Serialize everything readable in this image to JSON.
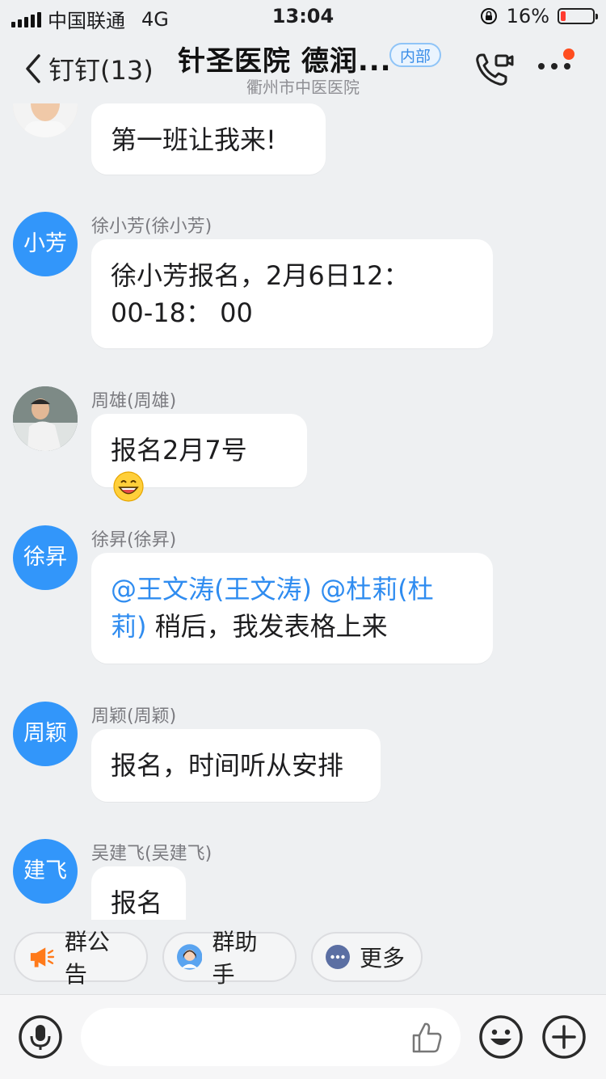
{
  "status_bar": {
    "carrier": "中国联通",
    "network": "4G",
    "time": "13:04",
    "battery": "16%",
    "battery_level": 0.16
  },
  "nav": {
    "back_label": "钉钉(13)",
    "title": "针圣医院 德润...",
    "tag": "内部",
    "subtitle": "衢州市中医医院"
  },
  "messages": [
    {
      "avatar_text": "",
      "sender": "",
      "text": "第一班让我来!"
    },
    {
      "avatar_text": "小芳",
      "sender": "徐小芳(徐小芳)",
      "line1": "徐小芳报名，2月6日12：",
      "line2": "00-18：  00"
    },
    {
      "avatar_text": "",
      "sender": "周雄(周雄)",
      "text": "报名2月7号"
    },
    {
      "avatar_text": "徐昇",
      "sender": "徐昇(徐昇)",
      "mention1": "@王文涛(王文涛)",
      "mention2a": "@杜莉(杜",
      "mention2b": "莉)",
      "rest": "稍后，我发表格上来"
    },
    {
      "avatar_text": "周颖",
      "sender": "周颖(周颖)",
      "text": "报名，时间听从安排"
    },
    {
      "avatar_text": "建飞",
      "sender": "吴建飞(吴建飞)",
      "text": "报名"
    }
  ],
  "quick_actions": [
    "群公告",
    "群助手",
    "更多"
  ],
  "colors": {
    "accent": "#3296fa",
    "mention": "#2f8cf0",
    "announce": "#ff7a1a",
    "battery": "#ff3b30"
  }
}
